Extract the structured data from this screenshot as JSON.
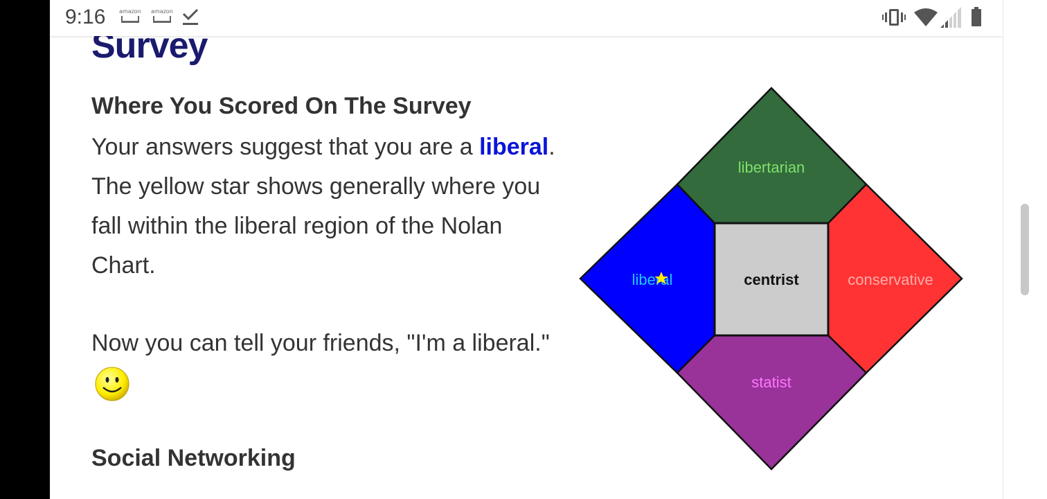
{
  "status_bar": {
    "time": "9:16",
    "notifications": [
      {
        "icon": "amazon-cart-icon",
        "label": "amazon"
      },
      {
        "icon": "amazon-cart-icon",
        "label": "amazon"
      },
      {
        "icon": "download-done-icon"
      }
    ],
    "system_icons": [
      "vibrate-icon",
      "wifi-icon",
      "signal-icon",
      "battery-icon"
    ]
  },
  "page": {
    "heading": "Survey",
    "result_title": "Where You Scored On The Survey",
    "result_text_before": "Your answers suggest that you are a ",
    "result_link": "liberal",
    "result_text_after": ". The yellow star shows generally where you fall within the liberal region of the Nolan Chart.",
    "friends_text": "Now you can tell your friends, \"I'm a liberal.\"",
    "smiley_icon": "smiley-face-icon",
    "social_title": "Social Networking"
  },
  "nolan_chart": {
    "regions": [
      {
        "id": "libertarian",
        "label": "libertarian",
        "fill": "#336b3d",
        "label_color": "#7fe06a"
      },
      {
        "id": "liberal",
        "label": "liberal",
        "fill": "#0000ff",
        "label_color": "#22c8ff"
      },
      {
        "id": "centrist",
        "label": "centrist",
        "fill": "#cccccc",
        "label_color": "#111111"
      },
      {
        "id": "conservative",
        "label": "conservative",
        "fill": "#ff3333",
        "label_color": "#ffaaaa"
      },
      {
        "id": "statist",
        "label": "statist",
        "fill": "#993399",
        "label_color": "#ff77ff"
      }
    ],
    "marker": {
      "icon": "yellow-star-icon",
      "color": "#ffee00",
      "region": "liberal"
    }
  },
  "colors": {
    "heading": "#1a1a6e",
    "link": "#0a14d8",
    "text": "#333333"
  }
}
